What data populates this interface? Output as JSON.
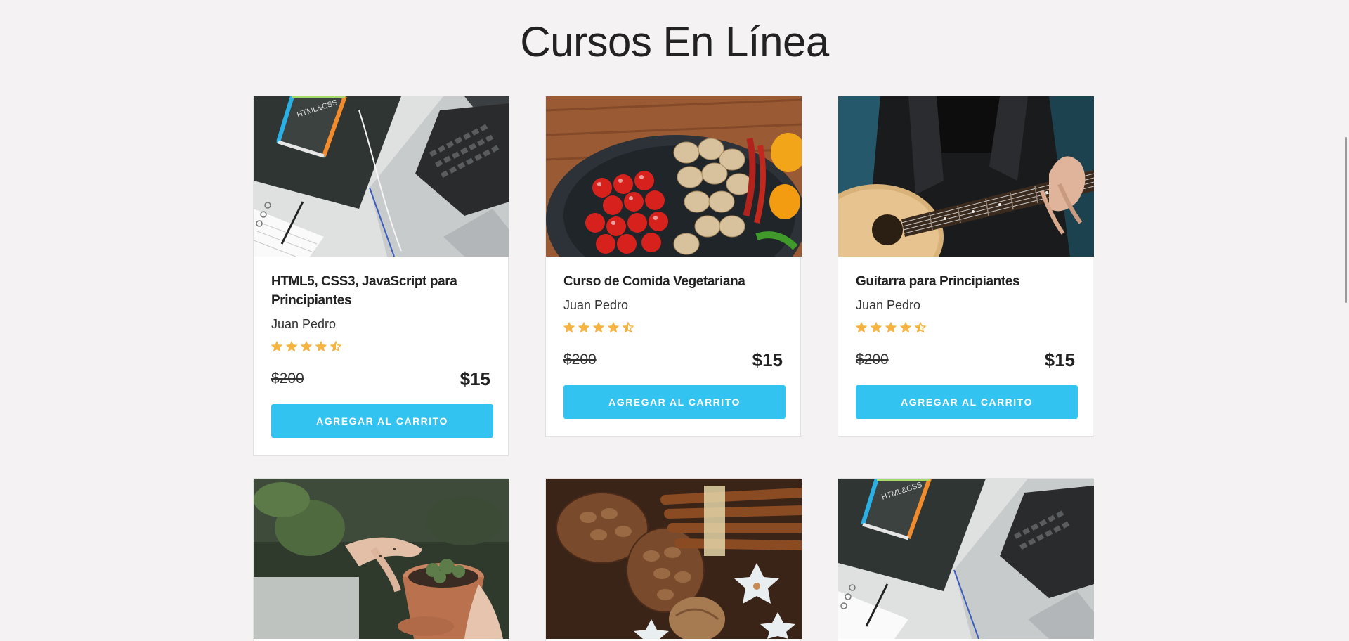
{
  "page": {
    "title": "Cursos En Línea"
  },
  "courses": [
    {
      "title": "HTML5, CSS3, JavaScript para Principiantes",
      "author": "Juan Pedro",
      "rating": 4.5,
      "old_price": "$200",
      "new_price": "$15",
      "button": "AGREGAR AL CARRITO",
      "image": "html-css-laptop"
    },
    {
      "title": "Curso de Comida Vegetariana",
      "author": "Juan Pedro",
      "rating": 4.5,
      "old_price": "$200",
      "new_price": "$15",
      "button": "AGREGAR AL CARRITO",
      "image": "vegetables-pan"
    },
    {
      "title": "Guitarra para Principiantes",
      "author": "Juan Pedro",
      "rating": 4.5,
      "old_price": "$200",
      "new_price": "$15",
      "button": "AGREGAR AL CARRITO",
      "image": "guitar-player"
    },
    {
      "image": "plant-pot-hands"
    },
    {
      "image": "cinnamon-pinecones"
    },
    {
      "image": "html-css-laptop"
    }
  ],
  "colors": {
    "background": "#f4f2f2",
    "accent": "#33c3f0",
    "star": "#f5b342",
    "text": "#222222"
  }
}
